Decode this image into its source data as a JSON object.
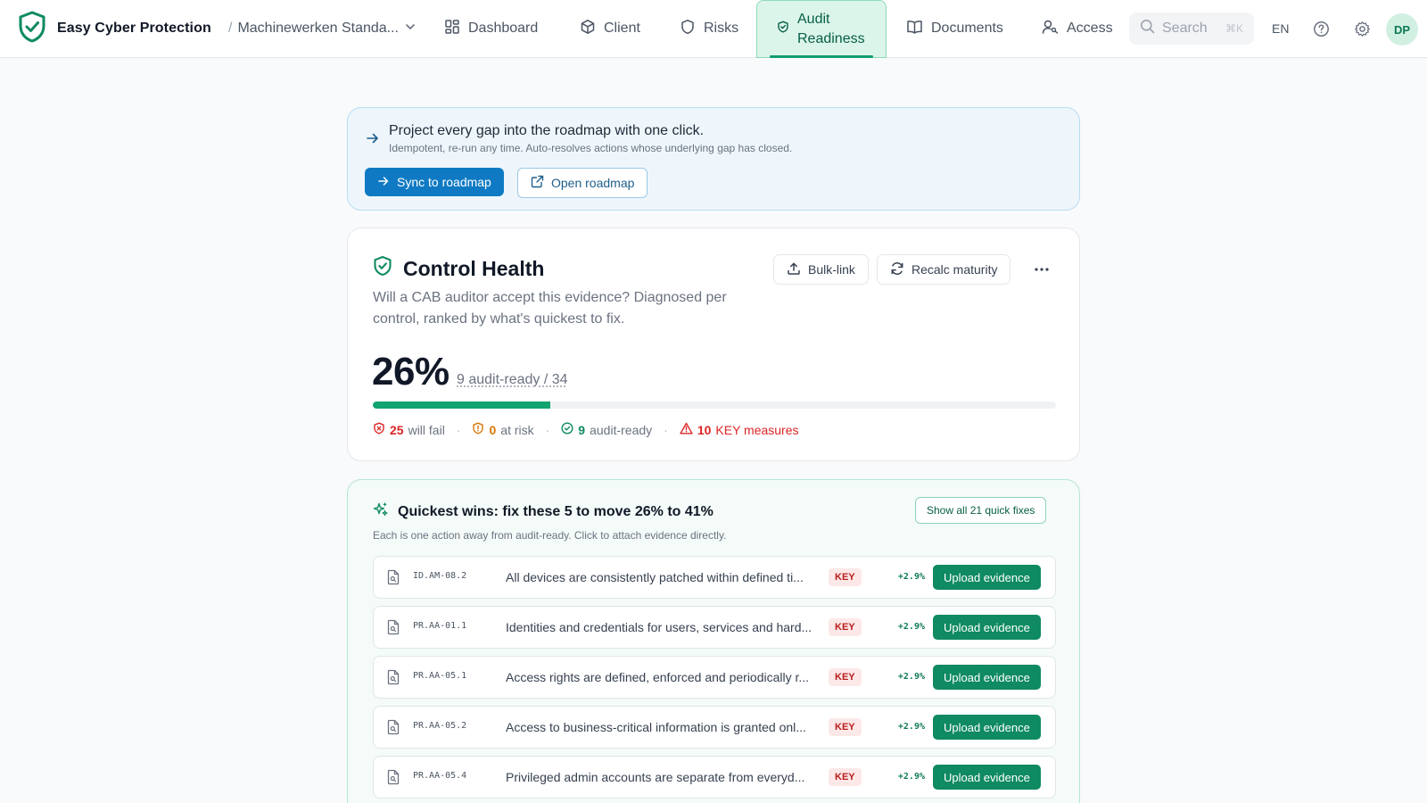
{
  "brand": {
    "name": "Easy Cyber Protection"
  },
  "tenant": {
    "name": "Machinewerken Standa..."
  },
  "nav": {
    "dashboard": "Dashboard",
    "client": "Client",
    "risks": "Risks",
    "audit_readiness": "Audit Readiness",
    "documents": "Documents",
    "access": "Access"
  },
  "search": {
    "placeholder": "Search",
    "shortcut": "⌘K"
  },
  "lang": "EN",
  "user": {
    "initials": "DP"
  },
  "sync": {
    "title": "Project every gap into the roadmap with one click.",
    "subtitle": "Idempotent, re-run any time. Auto-resolves actions whose underlying gap has closed.",
    "sync_label": "Sync to roadmap",
    "open_label": "Open roadmap"
  },
  "health": {
    "title": "Control Health",
    "description": "Will a CAB auditor accept this evidence? Diagnosed per control, ranked by what's quickest to fix.",
    "bulk_link_label": "Bulk-link",
    "recalc_label": "Recalc maturity",
    "percent": "26%",
    "progress": 0.26,
    "ready_summary": "9 audit-ready / 34",
    "stats": {
      "will_fail_count": "25",
      "will_fail_label": "will fail",
      "at_risk_count": "0",
      "at_risk_label": "at risk",
      "audit_ready_count": "9",
      "audit_ready_label": "audit-ready",
      "key_count": "10",
      "key_label": "KEY measures"
    }
  },
  "wins": {
    "title": "Quickest wins: fix these 5 to move 26% to 41%",
    "subtitle": "Each is one action away from audit-ready. Click to attach evidence directly.",
    "show_all_label": "Show all 21 quick fixes",
    "rows": [
      {
        "code": "ID.AM-08.2",
        "desc": "All devices are consistently patched within defined ti...",
        "badge": "KEY",
        "gain": "+2.9%",
        "action": "Upload evidence"
      },
      {
        "code": "PR.AA-01.1",
        "desc": "Identities and credentials for users, services and hard...",
        "badge": "KEY",
        "gain": "+2.9%",
        "action": "Upload evidence"
      },
      {
        "code": "PR.AA-05.1",
        "desc": "Access rights are defined, enforced and periodically r...",
        "badge": "KEY",
        "gain": "+2.9%",
        "action": "Upload evidence"
      },
      {
        "code": "PR.AA-05.2",
        "desc": "Access to business-critical information is granted onl...",
        "badge": "KEY",
        "gain": "+2.9%",
        "action": "Upload evidence"
      },
      {
        "code": "PR.AA-05.4",
        "desc": "Privileged admin accounts are separate from everyd...",
        "badge": "KEY",
        "gain": "+2.9%",
        "action": "Upload evidence"
      }
    ]
  },
  "colors": {
    "accent_green": "#0f8a62",
    "accent_blue": "#0f7ac3",
    "danger": "#dc2626",
    "warning": "#d97706"
  }
}
